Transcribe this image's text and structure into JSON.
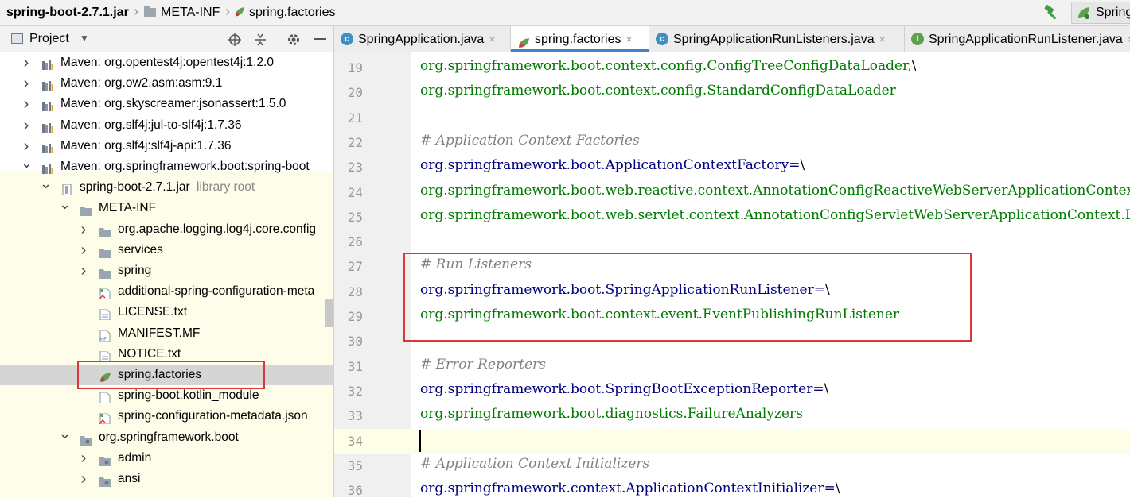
{
  "breadcrumb": {
    "jar": "spring-boot-2.7.1.jar",
    "folder": "META-INF",
    "file": "spring.factories"
  },
  "toolbar": {
    "run_config_label": "Spring"
  },
  "project_panel": {
    "title": "Project"
  },
  "tree": [
    {
      "label": "Maven: org.opentest4j:opentest4j:1.2.0",
      "indent": 0,
      "chevron": ">",
      "icon": "library-icon"
    },
    {
      "label": "Maven: org.ow2.asm:asm:9.1",
      "indent": 0,
      "chevron": ">",
      "icon": "library-icon"
    },
    {
      "label": "Maven: org.skyscreamer:jsonassert:1.5.0",
      "indent": 0,
      "chevron": ">",
      "icon": "library-icon"
    },
    {
      "label": "Maven: org.slf4j:jul-to-slf4j:1.7.36",
      "indent": 0,
      "chevron": ">",
      "icon": "library-icon"
    },
    {
      "label": "Maven: org.slf4j:slf4j-api:1.7.36",
      "indent": 0,
      "chevron": ">",
      "icon": "library-icon"
    },
    {
      "label": "Maven: org.springframework.boot:spring-boot",
      "indent": 0,
      "chevron": "v",
      "icon": "library-icon"
    },
    {
      "label": "spring-boot-2.7.1.jar",
      "suffix": "library root",
      "indent": 1,
      "chevron": "v",
      "icon": "jar-icon"
    },
    {
      "label": "META-INF",
      "indent": 2,
      "chevron": "v",
      "icon": "folder-icon"
    },
    {
      "label": "org.apache.logging.log4j.core.config",
      "indent": 3,
      "chevron": ">",
      "icon": "folder-icon"
    },
    {
      "label": "services",
      "indent": 3,
      "chevron": ">",
      "icon": "folder-icon"
    },
    {
      "label": "spring",
      "indent": 3,
      "chevron": ">",
      "icon": "folder-icon"
    },
    {
      "label": "additional-spring-configuration-meta",
      "indent": 3,
      "chevron": "",
      "icon": "json-file-icon"
    },
    {
      "label": "LICENSE.txt",
      "indent": 3,
      "chevron": "",
      "icon": "text-file-icon"
    },
    {
      "label": "MANIFEST.MF",
      "indent": 3,
      "chevron": "",
      "icon": "manifest-file-icon"
    },
    {
      "label": "NOTICE.txt",
      "indent": 3,
      "chevron": "",
      "icon": "text-file-icon"
    },
    {
      "label": "spring.factories",
      "indent": 3,
      "chevron": "",
      "icon": "spring-factories-icon",
      "selected": true
    },
    {
      "label": "spring-boot.kotlin_module",
      "indent": 3,
      "chevron": "",
      "icon": "file-icon"
    },
    {
      "label": "spring-configuration-metadata.json",
      "indent": 3,
      "chevron": "",
      "icon": "json-file-icon"
    },
    {
      "label": "org.springframework.boot",
      "indent": 2,
      "chevron": "v",
      "icon": "package-icon"
    },
    {
      "label": "admin",
      "indent": 3,
      "chevron": ">",
      "icon": "package-icon"
    },
    {
      "label": "ansi",
      "indent": 3,
      "chevron": ">",
      "icon": "package-icon"
    }
  ],
  "tabs": [
    {
      "label": "SpringApplication.java",
      "icon": "class-icon",
      "active": false
    },
    {
      "label": "spring.factories",
      "icon": "spring-factories-icon",
      "active": true
    },
    {
      "label": "SpringApplicationRunListeners.java",
      "icon": "class-icon",
      "active": false
    },
    {
      "label": "SpringApplicationRunListener.java",
      "icon": "interface-icon",
      "active": false
    }
  ],
  "code_lines": [
    {
      "n": "19",
      "kind": "val",
      "text": "org.springframework.boot.context.config.ConfigTreeConfigDataLoader,",
      "bs": "\\"
    },
    {
      "n": "20",
      "kind": "val",
      "text": "org.springframework.boot.context.config.StandardConfigDataLoader",
      "bs": ""
    },
    {
      "n": "21",
      "kind": "blank",
      "text": "",
      "bs": ""
    },
    {
      "n": "22",
      "kind": "comment",
      "text": "# Application Context Factories",
      "bs": ""
    },
    {
      "n": "23",
      "kind": "key",
      "text": "org.springframework.boot.ApplicationContextFactory=",
      "bs": "\\"
    },
    {
      "n": "24",
      "kind": "val",
      "text": "org.springframework.boot.web.reactive.context.AnnotationConfigReactiveWebServerApplicationContext.Factory,",
      "bs": ""
    },
    {
      "n": "25",
      "kind": "val",
      "text": "org.springframework.boot.web.servlet.context.AnnotationConfigServletWebServerApplicationContext.Factory",
      "bs": ""
    },
    {
      "n": "26",
      "kind": "blank",
      "text": "",
      "bs": ""
    },
    {
      "n": "27",
      "kind": "comment",
      "text": "# Run Listeners",
      "bs": ""
    },
    {
      "n": "28",
      "kind": "key",
      "text": "org.springframework.boot.SpringApplicationRunListener=",
      "bs": "\\"
    },
    {
      "n": "29",
      "kind": "val",
      "text": "org.springframework.boot.context.event.EventPublishingRunListener",
      "bs": ""
    },
    {
      "n": "30",
      "kind": "blank",
      "text": "",
      "bs": ""
    },
    {
      "n": "31",
      "kind": "comment",
      "text": "# Error Reporters",
      "bs": ""
    },
    {
      "n": "32",
      "kind": "key",
      "text": "org.springframework.boot.SpringBootExceptionReporter=",
      "bs": "\\"
    },
    {
      "n": "33",
      "kind": "val",
      "text": "org.springframework.boot.diagnostics.FailureAnalyzers",
      "bs": ""
    },
    {
      "n": "34",
      "kind": "blank",
      "text": "",
      "bs": ""
    },
    {
      "n": "35",
      "kind": "comment",
      "text": "# Application Context Initializers",
      "bs": ""
    },
    {
      "n": "36",
      "kind": "key",
      "text": "org.springframework.context.ApplicationContextInitializer=",
      "bs": "\\"
    }
  ],
  "colors": {
    "accent": "#4083c9",
    "annotation_red": "#d9363e",
    "comment": "#808080",
    "key": "#000080",
    "value": "#007a00"
  }
}
